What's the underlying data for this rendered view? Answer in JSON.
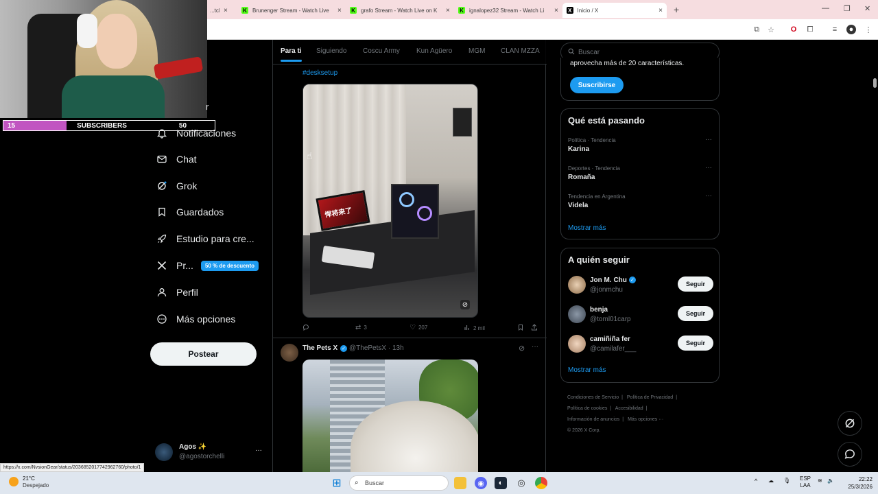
{
  "browser": {
    "tabs": [
      {
        "label": "...tch Live on Kick"
      },
      {
        "label": "Brunenger Stream - Watch Live",
        "favicon": "K"
      },
      {
        "label": "grafo Stream - Watch Live on K",
        "favicon": "K"
      },
      {
        "label": "ignalopez32 Stream - Watch Li",
        "favicon": "K"
      },
      {
        "label": "Inicio / X",
        "favicon": "X",
        "active": true
      }
    ]
  },
  "stream_overlay": {
    "sub_count": "15",
    "sub_label": "SUBSCRIBERS",
    "sub_goal": "50",
    "progress": 0.3
  },
  "left_nav": {
    "items": [
      {
        "label": "Notificaciones",
        "icon": "bell-icon"
      },
      {
        "label": "Chat",
        "icon": "mail-icon"
      },
      {
        "label": "Grok",
        "icon": "grok-icon"
      },
      {
        "label": "Guardados",
        "icon": "bookmark-icon"
      },
      {
        "label": "Estudio para cre...",
        "icon": "rocket-icon"
      },
      {
        "label": "Pr...",
        "icon": "x-logo-icon"
      },
      {
        "label": "Perfil",
        "icon": "person-icon"
      },
      {
        "label": "Más opciones",
        "icon": "more-circle-icon"
      }
    ],
    "partial_label": "r",
    "promo_badge": "50 % de descuento",
    "post_button": "Postear",
    "account": {
      "name": "Agos ✨",
      "handle": "@agostorchelli",
      "more": "···"
    }
  },
  "status_url": "https://x.com/NvsionGear/status/2036852017742962760/photo/1",
  "feed": {
    "tabs": [
      "Para ti",
      "Siguiendo",
      "Coscu Army",
      "Kun Agüero",
      "MGM",
      "CLAN MZZA"
    ],
    "active_tab": "Para ti",
    "tweet1": {
      "hashtag": "#desksetup",
      "monitor_text": "悍将来了",
      "actions": {
        "replies": "",
        "retweets": "3",
        "likes": "207",
        "views": "2 mil"
      }
    },
    "tweet2": {
      "name": "The Pets X",
      "handle": "@ThePetsX · 13h"
    }
  },
  "right_col": {
    "search_placeholder": "Buscar",
    "subscribe_text": "aprovecha más de 20 características.",
    "subscribe_button": "Suscribirse",
    "trends_title": "Qué está pasando",
    "trends": [
      {
        "context": "Política · Tendencia",
        "name": "Karina"
      },
      {
        "context": "Deportes · Tendencia",
        "name": "Romaña"
      },
      {
        "context": "Tendencia en Argentina",
        "name": "Videla"
      }
    ],
    "trends_more": "Mostrar más",
    "follow_title": "A quién seguir",
    "follow": [
      {
        "name": "Jon M. Chu",
        "handle": "@jonmchu",
        "verified": true,
        "button": "Seguir"
      },
      {
        "name": "benja",
        "handle": "@toml01carp",
        "verified": false,
        "button": "Seguir"
      },
      {
        "name": "camiñiña fer",
        "handle": "@camilafer___",
        "verified": false,
        "button": "Seguir"
      }
    ],
    "follow_more": "Mostrar más",
    "legal": [
      "Condiciones de Servicio",
      "|",
      "Política de Privacidad",
      "|",
      "Política de cookies",
      "|",
      "Accesibilidad",
      "|",
      "Información de anuncios",
      "|",
      "Más opciones ···",
      "© 2026 X Corp."
    ]
  },
  "taskbar": {
    "temp": "21°C",
    "weather": "Despejado",
    "search": "Buscar",
    "lang1": "ESP",
    "lang2": "LAA",
    "time": "22:22",
    "date": "25/3/2026"
  }
}
